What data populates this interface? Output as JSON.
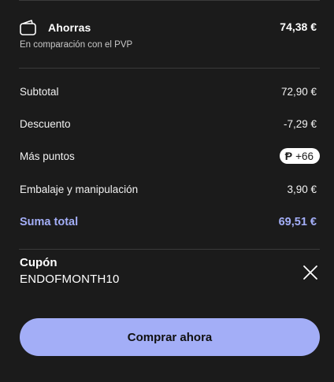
{
  "savings": {
    "label": "Ahorras",
    "value": "74,38 €",
    "subtitle": "En comparación con el PVP",
    "icon": "wallet-icon"
  },
  "summary": {
    "subtotal": {
      "label": "Subtotal",
      "value": "72,90 €"
    },
    "discount": {
      "label": "Descuento",
      "value": "-7,29 €"
    },
    "points": {
      "label": "Más puntos",
      "icon_glyph": "Ᵽ",
      "value": "+66"
    },
    "packaging": {
      "label": "Embalaje y manipulación",
      "value": "3,90 €"
    },
    "total": {
      "label": "Suma total",
      "value": "69,51 €"
    }
  },
  "coupon": {
    "title": "Cupón",
    "code": "ENDOFMONTH10",
    "remove_icon": "close-icon"
  },
  "cta": {
    "label": "Comprar ahora"
  },
  "colors": {
    "background": "#1b1b1b",
    "accent": "#a3aef7",
    "divider": "#3a3a3a",
    "text": "#ffffff",
    "muted_text": "#c9c9c9"
  }
}
